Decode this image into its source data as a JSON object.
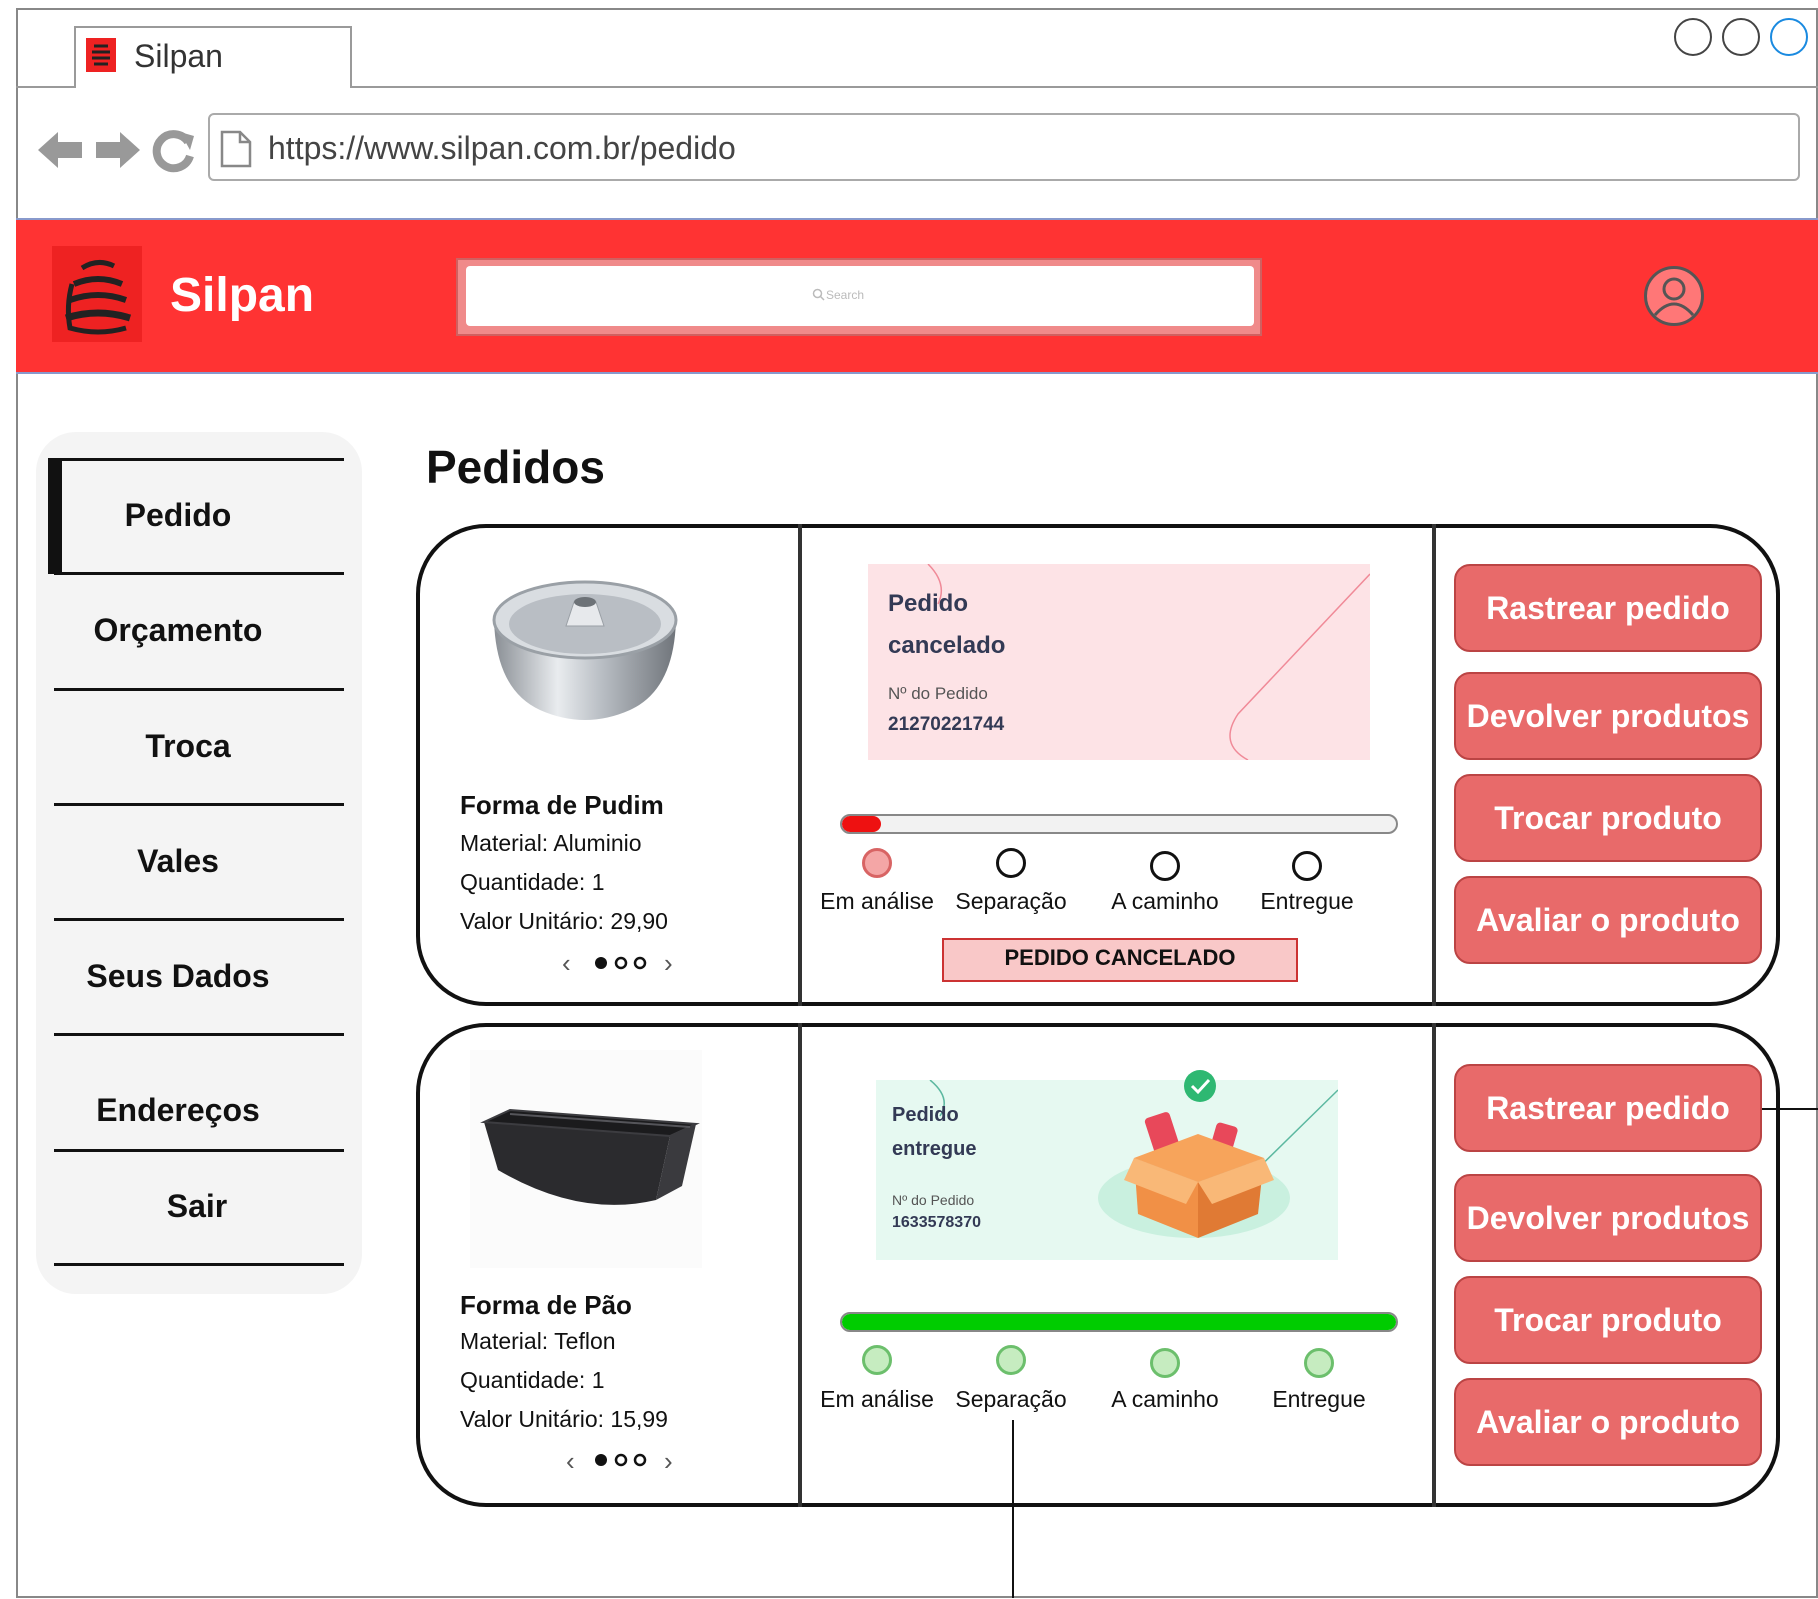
{
  "browser": {
    "tab_title": "Silpan",
    "url": "https://www.silpan.com.br/pedido"
  },
  "header": {
    "brand": "Silpan",
    "search_placeholder": "Search"
  },
  "sidebar": {
    "items": [
      {
        "label": "Pedido",
        "active": true
      },
      {
        "label": "Orçamento"
      },
      {
        "label": "Troca"
      },
      {
        "label": "Vales"
      },
      {
        "label": "Seus Dados"
      },
      {
        "label": "Endereços"
      },
      {
        "label": "Sair"
      }
    ]
  },
  "page_title": "Pedidos",
  "orders": [
    {
      "product_name": "Forma de Pudim",
      "material": "Material: Aluminio",
      "quantity": "Quantidade: 1",
      "unit_value": "Valor Unitário: 29,90",
      "status_line1": "Pedido",
      "status_line2": "cancelado",
      "order_label": "Nº do Pedido",
      "order_number": "21270221744",
      "progress": 0.07,
      "progress_color": "#ee1111",
      "steps": [
        "Em análise",
        "Separação",
        "A caminho",
        "Entregue"
      ],
      "badge": "PEDIDO CANCELADO",
      "panel_color": "#fde3e6",
      "accent": "#f08a98"
    },
    {
      "product_name": "Forma de Pão",
      "material": "Material: Teflon",
      "quantity": "Quantidade: 1",
      "unit_value": "Valor Unitário: 15,99",
      "status_line1": "Pedido",
      "status_line2": "entregue",
      "order_label": "Nº do Pedido",
      "order_number": "1633578370",
      "progress": 1.0,
      "progress_color": "#00cc00",
      "steps": [
        "Em análise",
        "Separação",
        "A caminho",
        "Entregue"
      ],
      "panel_color": "#e6f9f1",
      "accent": "#5cb8a0"
    }
  ],
  "actions": {
    "track": "Rastrear pedido",
    "return": "Devolver produtos",
    "exchange": "Trocar produto",
    "review": "Avaliar o produto"
  },
  "colors": {
    "header_red": "#ff3333",
    "button_red": "#e86a6a",
    "done_green": "#a8e0a0"
  },
  "icons": [
    "back-arrow-icon",
    "forward-arrow-icon",
    "reload-icon",
    "page-icon",
    "user-icon",
    "logo-icon",
    "search-icon",
    "check-icon",
    "box-icon",
    "chevron-left-icon",
    "chevron-right-icon"
  ]
}
